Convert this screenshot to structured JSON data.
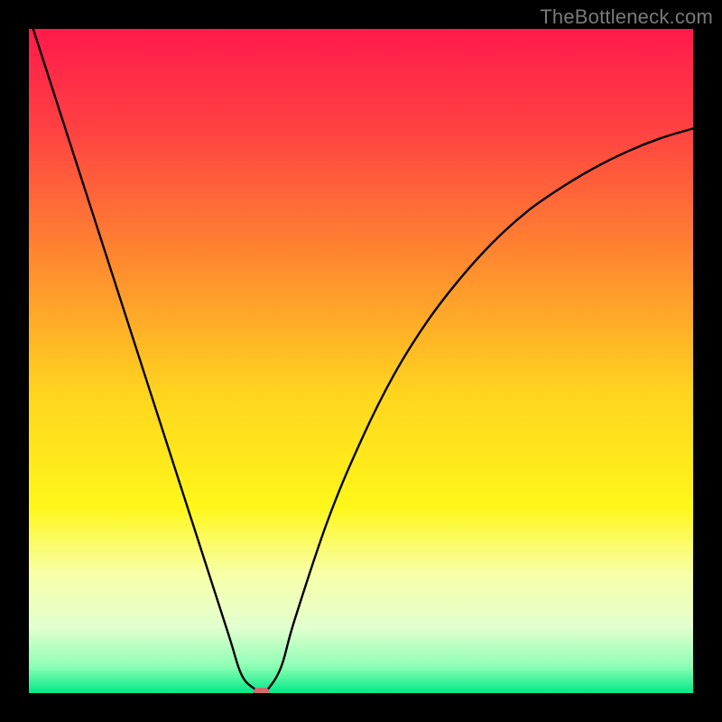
{
  "watermark": "TheBottleneck.com",
  "chart_data": {
    "type": "line",
    "title": "",
    "xlabel": "",
    "ylabel": "",
    "xlim": [
      0,
      100
    ],
    "ylim": [
      0,
      100
    ],
    "grid": false,
    "legend": false,
    "series": [
      {
        "name": "bottleneck-curve",
        "x": [
          0,
          5,
          10,
          15,
          20,
          25,
          30,
          32,
          34,
          35,
          36,
          38,
          40,
          45,
          50,
          55,
          60,
          65,
          70,
          75,
          80,
          85,
          90,
          95,
          100
        ],
        "y": [
          102,
          86.5,
          71,
          55.5,
          40,
          24.5,
          9,
          2.8,
          0.6,
          0,
          0.6,
          4,
          11,
          26,
          38,
          48,
          56,
          62.5,
          68,
          72.5,
          76,
          79,
          81.5,
          83.5,
          85
        ]
      }
    ],
    "marker": {
      "x": 35,
      "y": 0,
      "color": "#cf6a6f"
    },
    "gradient_stops": [
      {
        "offset": 0.0,
        "color": "#ff1a4b"
      },
      {
        "offset": 0.15,
        "color": "#ff4142"
      },
      {
        "offset": 0.35,
        "color": "#ff8a2f"
      },
      {
        "offset": 0.55,
        "color": "#ffd51e"
      },
      {
        "offset": 0.72,
        "color": "#fff71a"
      },
      {
        "offset": 0.82,
        "color": "#f8ffa8"
      },
      {
        "offset": 0.9,
        "color": "#e3ffcf"
      },
      {
        "offset": 0.96,
        "color": "#8dffb5"
      },
      {
        "offset": 1.0,
        "color": "#00e887"
      }
    ]
  }
}
